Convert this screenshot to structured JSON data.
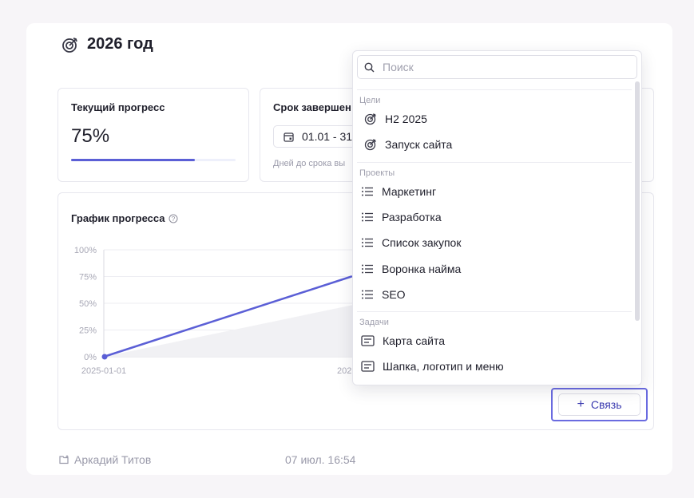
{
  "goal": {
    "title": "2026 год",
    "icon": "goal-target-icon"
  },
  "progress_panel": {
    "label": "Текущий прогресс",
    "value": "75%",
    "progress_fraction": 0.75
  },
  "deadline_panel": {
    "label": "Срок завершен",
    "date": "01.01 - 31",
    "days_label": "Дней до срока вы"
  },
  "chart_panel": {
    "title": "График прогресса",
    "help_icon": "question-circle-icon"
  },
  "chart_data": {
    "type": "line",
    "title": "",
    "xlabel": "",
    "ylabel": "",
    "y_ticks": [
      "100%",
      "75%",
      "50%",
      "25%",
      "0%"
    ],
    "x_tick_labels": [
      "2025-01-01",
      "202"
    ],
    "ylim": [
      0,
      100
    ],
    "grid": true,
    "series": [
      {
        "values": [
          0,
          75
        ]
      }
    ]
  },
  "link_button": {
    "label": "Связь",
    "plus": "+"
  },
  "footer": {
    "user": "Аркадий Титов",
    "time": "07 июл. 16:54"
  },
  "dropdown": {
    "search_placeholder": "Поиск",
    "sections": [
      {
        "title": "Цели",
        "items": [
          {
            "label": "H2 2025",
            "icon": "goal-target-icon"
          },
          {
            "label": "Запуск сайта",
            "icon": "goal-target-icon"
          }
        ]
      },
      {
        "title": "Проекты",
        "items": [
          {
            "label": "Маркетинг",
            "icon": "list-icon"
          },
          {
            "label": "Разработка",
            "icon": "list-icon"
          },
          {
            "label": "Список закупок",
            "icon": "list-icon"
          },
          {
            "label": "Воронка найма",
            "icon": "list-icon"
          },
          {
            "label": "SEO",
            "icon": "list-icon"
          }
        ]
      },
      {
        "title": "Задачи",
        "items": [
          {
            "label": "Карта сайта",
            "icon": "task-card-icon"
          },
          {
            "label": "Шапка, логотип и меню",
            "icon": "task-card-icon"
          }
        ]
      }
    ]
  },
  "colors": {
    "accent": "#5b5fd6",
    "focus_border": "#6a6be0",
    "muted": "#9a9aaa"
  }
}
